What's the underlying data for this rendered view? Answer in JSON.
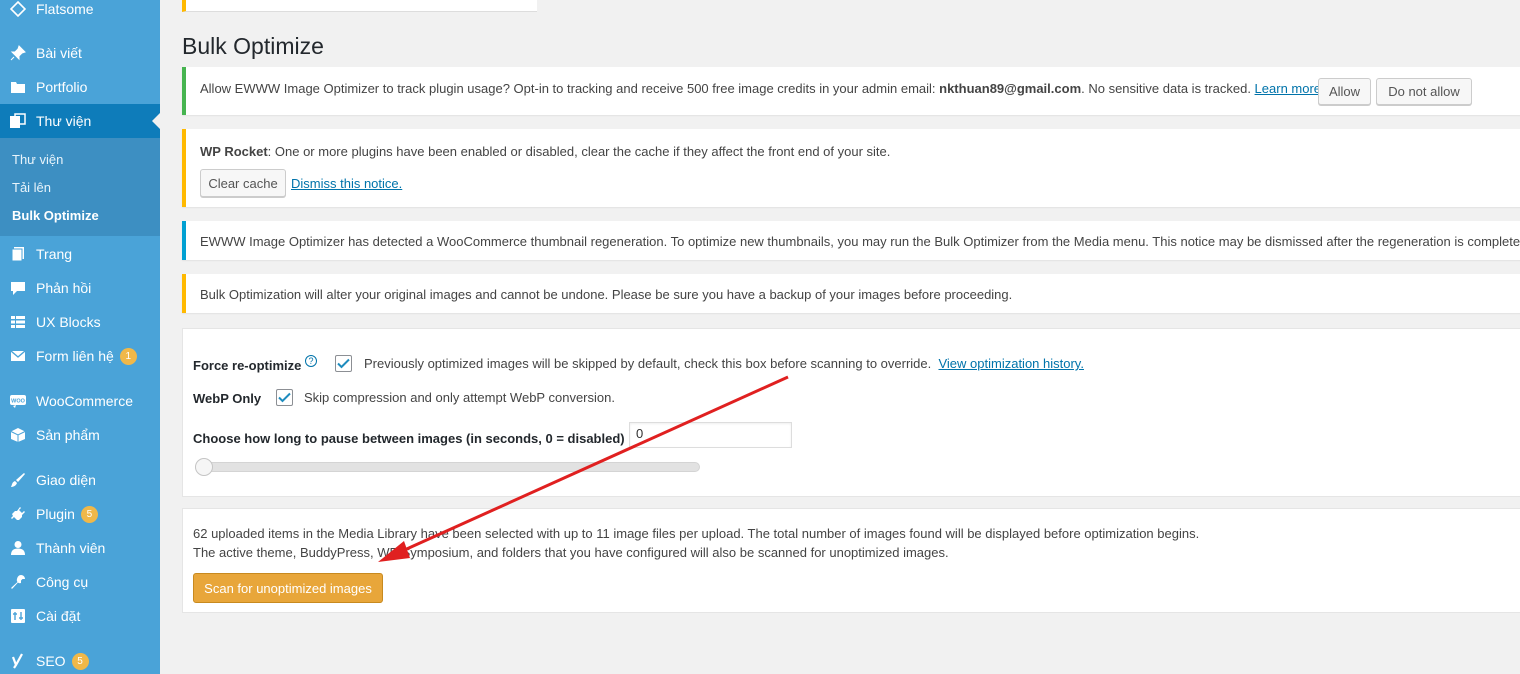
{
  "sidebar": {
    "items": [
      {
        "label": "Flatsome",
        "icon": "flatsome-diamond-icon"
      },
      {
        "label": "Bài viết",
        "icon": "pin-icon"
      },
      {
        "label": "Portfolio",
        "icon": "folder-icon"
      },
      {
        "label": "Thư viện",
        "icon": "media-icon"
      },
      {
        "label": "Trang",
        "icon": "page-icon"
      },
      {
        "label": "Phản hồi",
        "icon": "comment-icon"
      },
      {
        "label": "UX Blocks",
        "icon": "grid-icon"
      },
      {
        "label": "Form liên hệ",
        "icon": "mail-icon",
        "badge": "1"
      },
      {
        "label": "WooCommerce",
        "icon": "woo-icon"
      },
      {
        "label": "Sản phẩm",
        "icon": "box-icon"
      },
      {
        "label": "Giao diện",
        "icon": "brush-icon"
      },
      {
        "label": "Plugin",
        "icon": "plugin-icon",
        "badge": "5"
      },
      {
        "label": "Thành viên",
        "icon": "user-icon"
      },
      {
        "label": "Công cụ",
        "icon": "wrench-icon"
      },
      {
        "label": "Cài đặt",
        "icon": "settings-icon"
      },
      {
        "label": "SEO",
        "icon": "yoast-icon",
        "badge": "5"
      }
    ],
    "submenu": [
      "Thư viện",
      "Tải lên",
      "Bulk Optimize"
    ]
  },
  "page": {
    "title": "Bulk Optimize"
  },
  "notices": {
    "tracking": {
      "text_before": "Allow EWWW Image Optimizer to track plugin usage? Opt-in to tracking and receive 500 free image credits in your admin email: ",
      "email": "nkthuan89@gmail.com",
      "text_after": ". No sensitive data is tracked. ",
      "learn_more": "Learn more.",
      "allow": "Allow",
      "deny": "Do not allow"
    },
    "wprocket": {
      "title": "WP Rocket",
      "text": ": One or more plugins have been enabled or disabled, clear the cache if they affect the front end of your site.",
      "clear_cache": "Clear cache",
      "dismiss": "Dismiss this notice."
    },
    "regen": {
      "text": "EWWW Image Optimizer has detected a WooCommerce thumbnail regeneration. To optimize new thumbnails, you may run the Bulk Optimizer from the Media menu. This notice may be dismissed after the regeneration is complete."
    },
    "warning": {
      "text": "Bulk Optimization will alter your original images and cannot be undone. Please be sure you have a backup of your images before proceeding."
    }
  },
  "options": {
    "force_label": "Force re-optimize",
    "force_desc": "Previously optimized images will be skipped by default, check this box before scanning to override.",
    "history_link": "View optimization history.",
    "webp_label": "WebP Only",
    "webp_desc": "Skip compression and only attempt WebP conversion.",
    "pause_label": "Choose how long to pause between images (in seconds, 0 = disabled)",
    "pause_value": "0",
    "force_checked": true,
    "webp_checked": true,
    "slider_value": 0
  },
  "scan": {
    "line1": "62 uploaded items in the Media Library have been selected with up to 11 image files per upload. The total number of images found will be displayed before optimization begins.",
    "line2": "The active theme, BuddyPress, WP Symposium, and folders that you have configured will also be scanned for unoptimized images.",
    "button": "Scan for unoptimized images"
  },
  "colors": {
    "sidebar": "#4aa3d8",
    "current": "#0e7cba",
    "arrow": "#e02020",
    "primary": "#e8a63a"
  }
}
